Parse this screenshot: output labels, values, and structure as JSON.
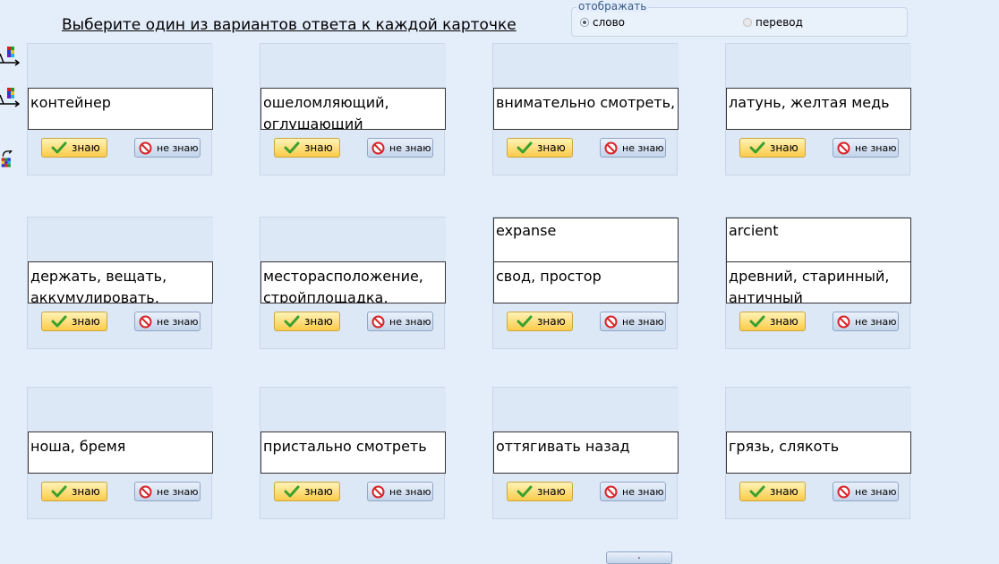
{
  "header": {
    "title": "Выберите один из вариантов ответа к каждой карточке"
  },
  "display": {
    "legend": "отображать",
    "options": [
      {
        "label": "слово",
        "checked": true
      },
      {
        "label": "перевод",
        "checked": false
      }
    ]
  },
  "buttons": {
    "know": "знаю",
    "dont_know": "не знаю"
  },
  "cards": [
    {
      "front": "",
      "back": "контейнер"
    },
    {
      "front": "",
      "back": "ошеломляющий, оглушающий"
    },
    {
      "front": "",
      "back": "внимательно смотреть,"
    },
    {
      "front": "",
      "back": "латунь, желтая медь"
    },
    {
      "front": "",
      "back": "держать, вещать, аккумулировать,"
    },
    {
      "front": "",
      "back": "месторасположение, стройплощадка,"
    },
    {
      "front": "expanse",
      "back": "свод, простор"
    },
    {
      "front": "arcient",
      "back": "древний, старинный, античный"
    },
    {
      "front": "",
      "back": "ноша, бремя"
    },
    {
      "front": "",
      "back": "пристально смотреть"
    },
    {
      "front": "",
      "back": "оттягивать назад"
    },
    {
      "front": "",
      "back": "грязь, слякоть"
    }
  ],
  "side_tools": [
    "grid-arrow-icon",
    "grid-arrow-icon",
    "grid-rotate-icon"
  ],
  "colors": {
    "know_button": "#fccb4a",
    "dont_know_button": "#c3d4ea",
    "background": "#e4eefa",
    "check": "#3aa02e",
    "forbid": "#d8262a"
  }
}
